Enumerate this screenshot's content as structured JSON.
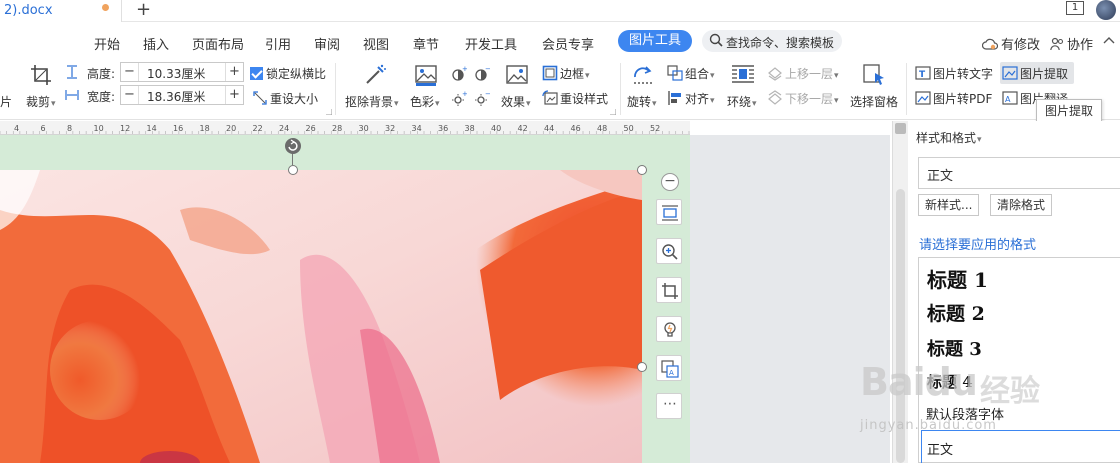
{
  "tabbar": {
    "doc_name": "2).docx",
    "new_tab": "+",
    "window_badge": "1"
  },
  "menu": {
    "items": [
      "开始",
      "插入",
      "页面布局",
      "引用",
      "审阅",
      "视图",
      "章节",
      "开发工具",
      "会员专享"
    ],
    "active": "图片工具",
    "search": "查找命令、搜索模板",
    "modified": "有修改",
    "collab": "协作"
  },
  "ribbon": {
    "crop": "裁剪",
    "height_label": "高度:",
    "height_value": "10.33厘米",
    "width_label": "宽度:",
    "width_value": "18.36厘米",
    "lock_ratio": "锁定纵横比",
    "reset_size": "重设大小",
    "remove_bg": "抠除背景",
    "color": "色彩",
    "effects": "效果",
    "border": "边框",
    "reset_style": "重设样式",
    "rotate": "旋转",
    "group": "组合",
    "align": "对齐",
    "wrap": "环绕",
    "bring_forward": "上移一层",
    "send_backward": "下移一层",
    "selection_pane": "选择窗格",
    "pic_to_text": "图片转文字",
    "pic_extract": "图片提取",
    "pic_to_pdf": "图片转PDF",
    "pic_translate": "图片翻译",
    "left_cut": "片",
    "minus": "−",
    "plus": "+"
  },
  "tooltip": "图片提取",
  "ruler": {
    "labels": [
      "4",
      "6",
      "8",
      "10",
      "12",
      "14",
      "16",
      "18",
      "20",
      "22",
      "24",
      "26",
      "28",
      "30",
      "32",
      "34",
      "36",
      "38",
      "40",
      "42",
      "44",
      "46",
      "48",
      "50",
      "52"
    ]
  },
  "image_tools": {
    "more": "⋯",
    "minus": "−"
  },
  "styles_pane": {
    "title": "样式和格式",
    "current": "正文",
    "new_style": "新样式...",
    "clear_format": "清除格式",
    "hint": "请选择要应用的格式",
    "styles": [
      {
        "name": "标题 1",
        "size": 20
      },
      {
        "name": "标题 2",
        "size": 19
      },
      {
        "name": "标题 3",
        "size": 18
      },
      {
        "name": "标题 4",
        "size": 15
      }
    ],
    "default_font": "默认段落字体",
    "selected": "正文"
  },
  "watermark": {
    "brand": "Baidu",
    "suffix": "经验",
    "url": "jingyan.baidu.com"
  },
  "colors": {
    "accent": "#3d86f0",
    "doc_tab_text": "#2a6fd6",
    "selection_band": "#d5ebd7"
  }
}
